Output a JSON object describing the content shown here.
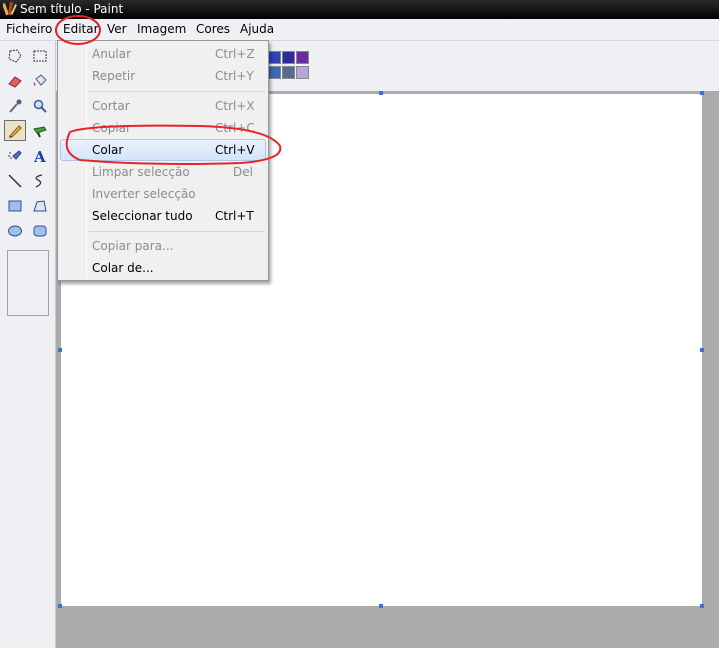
{
  "window": {
    "title": "Sem título - Paint",
    "app_icon": "paint-icon"
  },
  "menubar": {
    "items": [
      {
        "label": "Ficheiro"
      },
      {
        "label": "Editar"
      },
      {
        "label": "Ver"
      },
      {
        "label": "Imagem"
      },
      {
        "label": "Cores"
      },
      {
        "label": "Ajuda"
      }
    ]
  },
  "edit_menu": {
    "items": [
      {
        "label": "Anular",
        "shortcut": "Ctrl+Z",
        "enabled": false
      },
      {
        "label": "Repetir",
        "shortcut": "Ctrl+Y",
        "enabled": false
      },
      {
        "label": "Cortar",
        "shortcut": "Ctrl+X",
        "enabled": false
      },
      {
        "label": "Copiar",
        "shortcut": "Ctrl+C",
        "enabled": false
      },
      {
        "label": "Colar",
        "shortcut": "Ctrl+V",
        "enabled": true,
        "highlighted": true
      },
      {
        "label": "Limpar selecção",
        "shortcut": "Del",
        "enabled": false
      },
      {
        "label": "Inverter selecção",
        "shortcut": "",
        "enabled": false
      },
      {
        "label": "Seleccionar tudo",
        "shortcut": "Ctrl+T",
        "enabled": true
      },
      {
        "label": "Copiar para...",
        "shortcut": "",
        "enabled": false
      },
      {
        "label": "Colar de...",
        "shortcut": "",
        "enabled": true
      }
    ]
  },
  "toolbox": {
    "tools": [
      "free-select-icon",
      "rect-select-icon",
      "eraser-icon",
      "fill-bucket-icon",
      "color-picker-icon",
      "magnifier-icon",
      "pencil-icon",
      "brush-icon",
      "airbrush-icon",
      "text-icon",
      "line-icon",
      "curve-icon",
      "rectangle-icon",
      "polygon-icon",
      "ellipse-icon",
      "rounded-rect-icon"
    ],
    "selected_tool": "pencil-icon"
  },
  "palette": {
    "top_row": [
      "#2f44b5",
      "#2c2b9e",
      "#6a2aa0"
    ],
    "bottom_row": [
      "#3f69b6",
      "#536c96",
      "#b5a6d8"
    ]
  },
  "annotation": {
    "color": "#e8232a"
  }
}
